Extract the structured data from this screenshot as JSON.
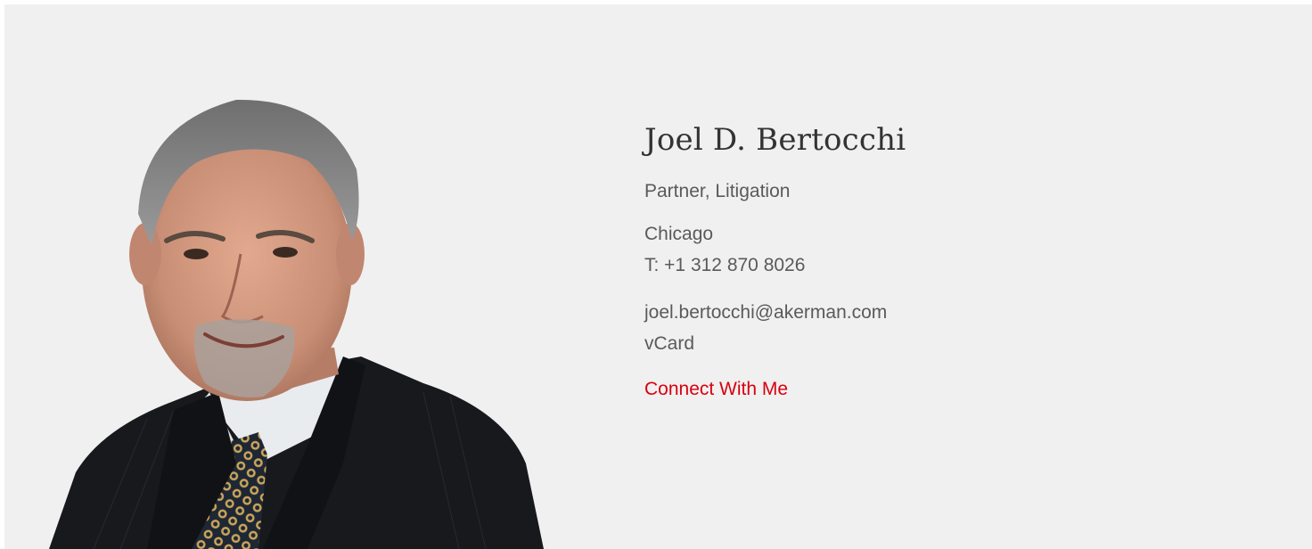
{
  "profile": {
    "name": "Joel D. Bertocchi",
    "role": "Partner, Litigation",
    "office": "Chicago",
    "phone": "T: +1 312 870 8026",
    "email": "joel.bertocchi@akerman.com",
    "vcard_label": "vCard",
    "connect_label": "Connect With Me"
  },
  "colors": {
    "panel_background": "#f0f0f0",
    "accent": "#d8000f",
    "text": "#5a5a5a",
    "name": "#333333"
  },
  "photo": {
    "icon": "person-portrait"
  }
}
